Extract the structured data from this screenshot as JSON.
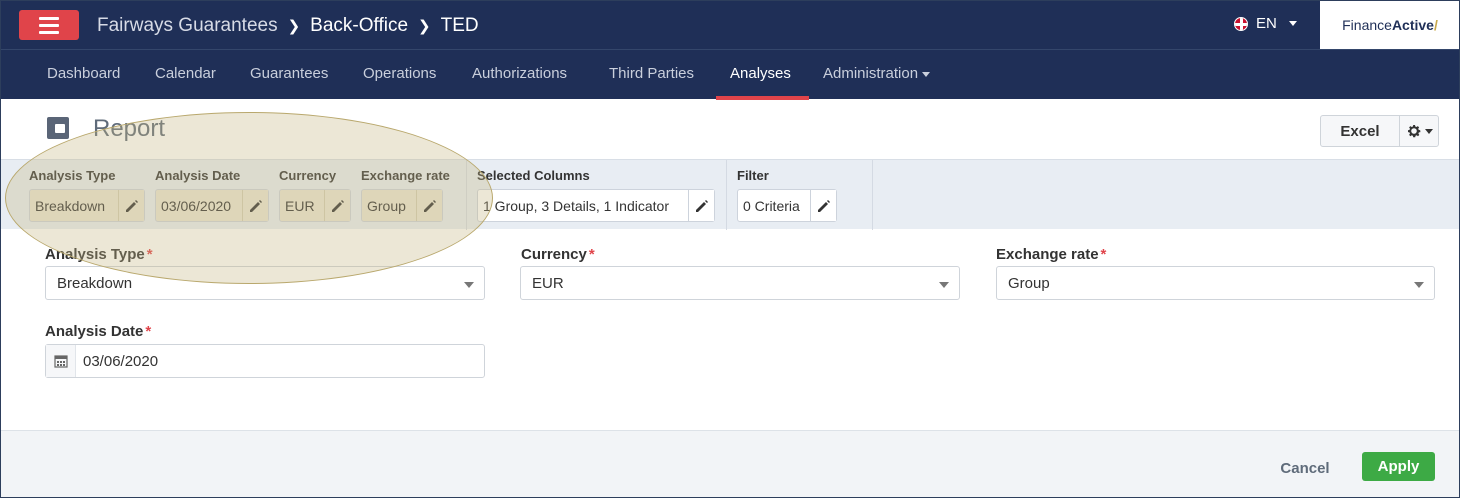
{
  "header": {
    "breadcrumb": [
      "Fairways Guarantees",
      "Back-Office",
      "TED"
    ],
    "language": "EN",
    "brand_prefix": "Finance",
    "brand_bold": "Active",
    "brand_mark": "/"
  },
  "nav": {
    "items": [
      "Dashboard",
      "Calendar",
      "Guarantees",
      "Operations",
      "Authorizations",
      "Third Parties",
      "Analyses",
      "Administration"
    ],
    "active": "Analyses"
  },
  "report": {
    "title": "Report",
    "excel_label": "Excel"
  },
  "summary": {
    "analysis_type": {
      "label": "Analysis Type",
      "value": "Breakdown"
    },
    "analysis_date": {
      "label": "Analysis Date",
      "value": "03/06/2020"
    },
    "currency": {
      "label": "Currency",
      "value": "EUR"
    },
    "exchange_rate": {
      "label": "Exchange rate",
      "value": "Group"
    },
    "selected_columns": {
      "label": "Selected Columns",
      "value": "1 Group, 3 Details, 1 Indicator"
    },
    "filter": {
      "label": "Filter",
      "value": "0 Criteria"
    }
  },
  "form": {
    "analysis_type": {
      "label": "Analysis Type",
      "value": "Breakdown"
    },
    "currency": {
      "label": "Currency",
      "value": "EUR"
    },
    "exchange_rate": {
      "label": "Exchange rate",
      "value": "Group"
    },
    "analysis_date": {
      "label": "Analysis Date",
      "value": "03/06/2020"
    },
    "required_marker": "*"
  },
  "footer": {
    "cancel_label": "Cancel",
    "apply_label": "Apply"
  },
  "colors": {
    "navbar": "#1f2f57",
    "accent": "#e0444a",
    "apply": "#3daa45",
    "highlight": "#c5b782"
  }
}
